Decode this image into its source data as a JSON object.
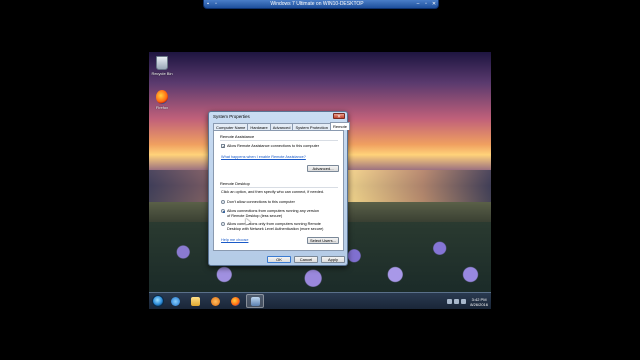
{
  "remote_bar": {
    "title": "Windows 7 Ultimate on WIN10-DESKTOP"
  },
  "desktop_icons": [
    {
      "label": "Recycle Bin",
      "icon": "recycle-bin-icon"
    },
    {
      "label": "Firefox",
      "icon": "firefox-icon"
    }
  ],
  "dialog": {
    "title": "System Properties",
    "close_label": "✕",
    "tabs": [
      {
        "label": "Computer Name",
        "active": false
      },
      {
        "label": "Hardware",
        "active": false
      },
      {
        "label": "Advanced",
        "active": false
      },
      {
        "label": "System Protection",
        "active": false
      },
      {
        "label": "Remote",
        "active": true
      }
    ],
    "remote_assistance": {
      "heading": "Remote Assistance",
      "allow_label": "Allow Remote Assistance connections to this computer",
      "allow_checked": true,
      "help_link": "What happens when I enable Remote Assistance?",
      "advanced_button": "Advanced..."
    },
    "remote_desktop": {
      "heading": "Remote Desktop",
      "instruction": "Click an option, and then specify who can connect, if needed.",
      "options": [
        {
          "label": "Don't allow connections to this computer",
          "selected": false
        },
        {
          "label": "Allow connections from computers running any version of Remote Desktop (less secure)",
          "selected": true
        },
        {
          "label": "Allow connections only from computers running Remote Desktop with Network Level Authentication (more secure)",
          "selected": false
        }
      ],
      "help_link": "Help me choose",
      "select_users_button": "Select Users..."
    },
    "buttons": {
      "ok": "OK",
      "cancel": "Cancel",
      "apply": "Apply"
    }
  },
  "taskbar": {
    "items": [
      "start-orb",
      "internet-explorer-icon",
      "folder-icon",
      "media-player-icon",
      "firefox-icon",
      "system-properties-icon"
    ],
    "clock_time": "3:42 PM",
    "clock_date": "8/26/2016"
  }
}
